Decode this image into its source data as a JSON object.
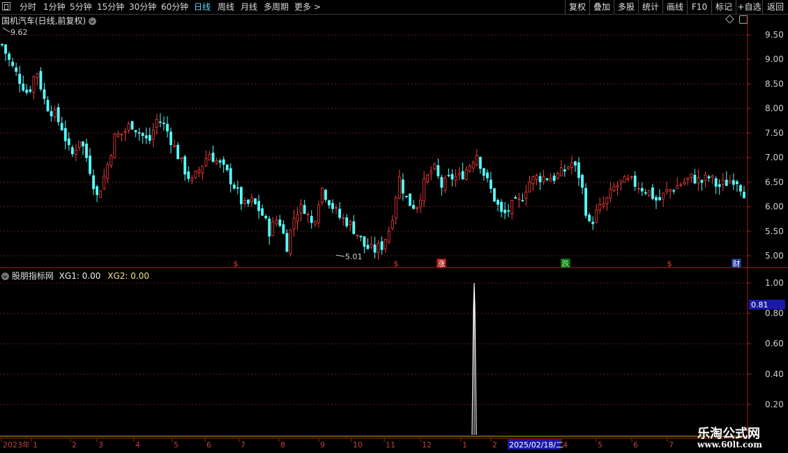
{
  "toolbar": {
    "periods": [
      "分时",
      "1分钟",
      "5分钟",
      "15分钟",
      "30分钟",
      "60分钟",
      "日线",
      "周线",
      "月线",
      "多周期",
      "更多 >"
    ],
    "active_period": "日线",
    "right_buttons": [
      "复权",
      "叠加",
      "多股",
      "统计",
      "画线",
      "F10",
      "标记",
      "+自选",
      "返回"
    ]
  },
  "main_chart": {
    "title": "国机汽车(日线,前复权)",
    "high_marker": "9.62",
    "low_marker": "5.01",
    "y_ticks": [
      "9.50",
      "9.00",
      "8.50",
      "8.00",
      "7.50",
      "7.00",
      "6.50",
      "6.00",
      "5.50",
      "5.00"
    ],
    "event_markers": [
      "$",
      "$",
      "涨",
      "跌",
      "$",
      "财"
    ]
  },
  "indicator": {
    "title": "股朋指标网",
    "xg1_label": "XG1: 0.00",
    "xg2_label": "XG2: 0.00",
    "y_ticks": [
      "1.00",
      "0.80",
      "0.60",
      "0.40",
      "0.20"
    ],
    "cursor_value": "0.81"
  },
  "timeline": {
    "labels": [
      "2023年",
      "1",
      "2",
      "3",
      "4",
      "5",
      "6",
      "7",
      "8",
      "9",
      "10",
      "11",
      "12",
      "1",
      "2",
      "2025/02/18/二",
      "4",
      "5",
      "6",
      "7"
    ]
  },
  "logo": {
    "line1": "乐淘公式网",
    "line2": "www.60lt.com"
  },
  "colors": {
    "up": "#ff3c3c",
    "down": "#54ffff",
    "axis": "#b01c1c",
    "grid": "#6e1414",
    "accent": "#5fd7ff"
  },
  "chart_data": {
    "type": "candlestick",
    "title": "国机汽车(日线,前复权)",
    "ylim": [
      4.85,
      9.85
    ],
    "y_ticks": [
      9.5,
      9.0,
      8.5,
      8.0,
      7.5,
      7.0,
      6.5,
      6.0,
      5.5,
      5.0
    ],
    "close_path": [
      9.3,
      8.9,
      8.6,
      8.3,
      8.8,
      8.1,
      7.9,
      7.6,
      7.0,
      7.4,
      6.9,
      6.2,
      6.7,
      7.4,
      7.5,
      7.7,
      7.5,
      7.3,
      7.8,
      7.6,
      7.2,
      6.8,
      6.5,
      6.8,
      7.1,
      6.9,
      6.7,
      6.4,
      6.0,
      6.1,
      5.9,
      5.5,
      5.8,
      5.2,
      5.9,
      6.0,
      5.6,
      6.4,
      6.1,
      5.8,
      5.7,
      5.5,
      5.2,
      5.1,
      5.2,
      5.6,
      6.6,
      6.1,
      6.0,
      6.5,
      6.8,
      6.4,
      6.6,
      6.6,
      6.8,
      7.1,
      6.6,
      6.2,
      5.8,
      6.0,
      6.1,
      6.5,
      6.6,
      6.6,
      6.6,
      6.7,
      6.9,
      6.6,
      5.6,
      5.9,
      6.1,
      6.4,
      6.5,
      6.5,
      6.4,
      6.3,
      6.1,
      6.3,
      6.4,
      6.5,
      6.6,
      6.5,
      6.6,
      6.4,
      6.5,
      6.6,
      6.3
    ],
    "indicator_series": [
      {
        "name": "XG1",
        "spike_at_fraction": 0.6,
        "peak": 1.0
      }
    ],
    "indicator_ylim": [
      0,
      1.05
    ]
  }
}
